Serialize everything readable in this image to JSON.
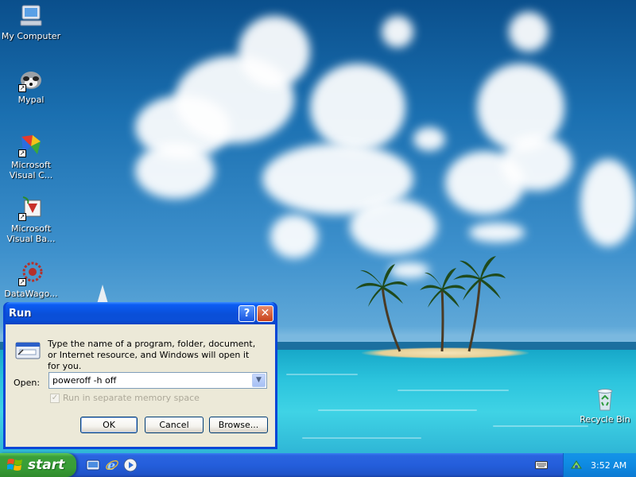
{
  "desktop": {
    "icons": [
      {
        "label": "My Computer"
      },
      {
        "label": "Mypal"
      },
      {
        "label": "Microsoft Visual C..."
      },
      {
        "label": "Microsoft Visual Ba..."
      },
      {
        "label": "DataWago..."
      },
      {
        "label": "Recycle Bin"
      }
    ]
  },
  "run_dialog": {
    "title": "Run",
    "help_glyph": "?",
    "close_glyph": "✕",
    "description": "Type the name of a program, folder, document, or Internet resource, and Windows will open it for you.",
    "open_label": "Open:",
    "open_value": "poweroff -h off",
    "checkbox_label": "Run in separate memory space",
    "checkbox_checked": true,
    "buttons": {
      "ok": "OK",
      "cancel": "Cancel",
      "browse": "Browse..."
    }
  },
  "taskbar": {
    "start_label": "start",
    "quick_launch": [
      "show-desktop-icon",
      "internet-explorer-icon",
      "media-player-icon"
    ],
    "clock": "3:52 AM"
  }
}
